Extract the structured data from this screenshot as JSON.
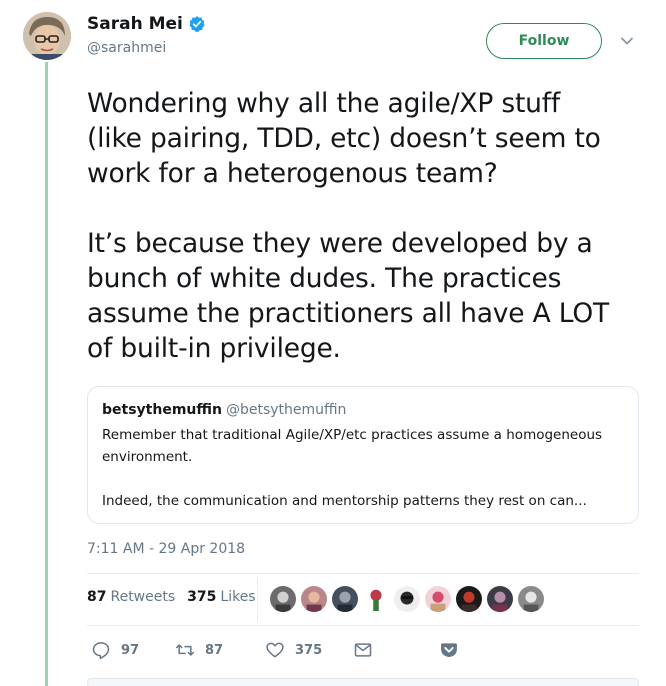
{
  "author": {
    "name": "Sarah Mei",
    "handle": "@sarahmei",
    "verified": true
  },
  "follow_button": {
    "label": "Follow"
  },
  "tweet": {
    "text": "Wondering why all the agile/XP stuff\n(like pairing, TDD, etc) doesn’t seem to\nwork for a heterogenous team?\n\nIt’s because they were developed by a\nbunch of white dudes. The practices\nassume the practitioners all have A LOT\nof built-in privilege."
  },
  "quote": {
    "name": "betsythemuffin",
    "handle": "@betsythemuffin",
    "text": "Remember that traditional Agile/XP/etc practices assume a homogeneous\nenvironment.\n\nIndeed, the communication and mentorship patterns they rest on can..."
  },
  "timestamp": "7:11 AM - 29 Apr 2018",
  "stats": {
    "retweets_count": "87",
    "retweets_label": "Retweets",
    "likes_count": "375",
    "likes_label": "Likes"
  },
  "actions": {
    "replies": "97",
    "retweets": "87",
    "likes": "375"
  },
  "icons": {
    "verified": "verified-badge-icon",
    "chevron": "chevron-down-icon",
    "reply": "reply-icon",
    "retweet": "retweet-icon",
    "like": "heart-icon",
    "dm": "envelope-icon",
    "pocket": "pocket-icon"
  },
  "colors": {
    "follow_accent": "#2e8b57",
    "verified_blue": "#1da1f2",
    "thread_line": "#9fd1ab",
    "secondary_text": "#657786"
  }
}
